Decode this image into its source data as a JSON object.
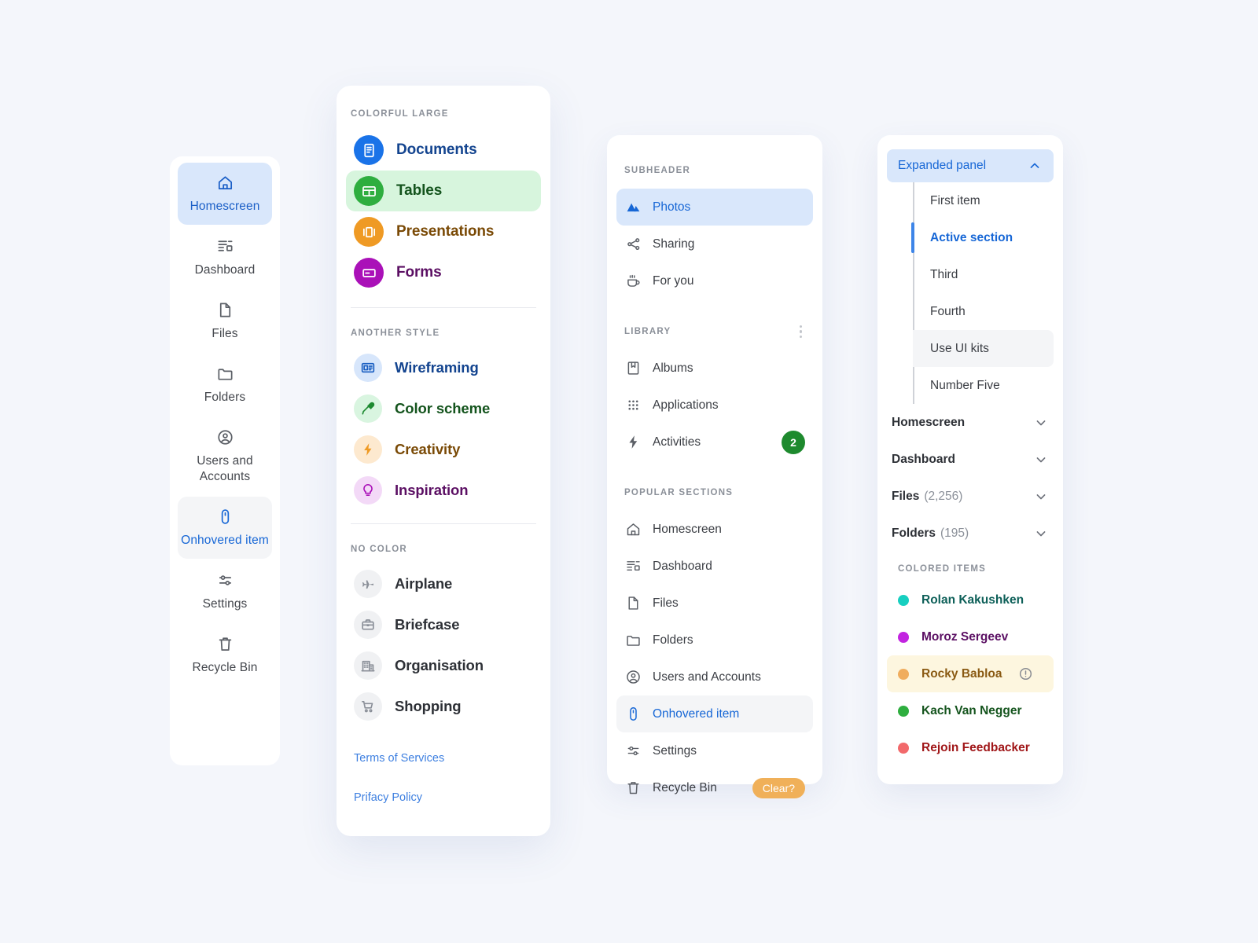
{
  "canvas": {
    "background": "#f4f6fb",
    "accent": "#1767d6"
  },
  "panel_rail": {
    "name": "icon-rail-navigation",
    "items": [
      {
        "label": "Homescreen",
        "icon": "home-icon",
        "state": "active"
      },
      {
        "label": "Dashboard",
        "icon": "dashboard-icon",
        "state": "default"
      },
      {
        "label": "Files",
        "icon": "file-icon",
        "state": "default"
      },
      {
        "label": "Folders",
        "icon": "folder-icon",
        "state": "default"
      },
      {
        "label": "Users and Accounts",
        "icon": "user-circle-icon",
        "state": "default"
      },
      {
        "label": "Onhovered item",
        "icon": "mouse-icon",
        "state": "hovered"
      },
      {
        "label": "Settings",
        "icon": "sliders-icon",
        "state": "default"
      },
      {
        "label": "Recycle Bin",
        "icon": "trash-icon",
        "state": "default"
      }
    ]
  },
  "panel_colorful": {
    "name": "colorful-large-navigation",
    "groups": [
      {
        "label": "Colorful large",
        "style": "solid-badge",
        "items": [
          {
            "label": "Documents",
            "icon": "document-icon",
            "badge_bg": "#1a73e8",
            "text_color": "#13448f",
            "selected": false
          },
          {
            "label": "Tables",
            "icon": "table-icon",
            "badge_bg": "#2eae3f",
            "text_color": "#14541d",
            "selected": true,
            "row_bg": "#d7f5dd"
          },
          {
            "label": "Presentations",
            "icon": "presentation-icon",
            "badge_bg": "#ef9a24",
            "text_color": "#7a4a06",
            "selected": false
          },
          {
            "label": "Forms",
            "icon": "form-icon",
            "badge_bg": "#aa11b8",
            "text_color": "#5b0f63",
            "selected": false
          }
        ]
      },
      {
        "label": "Another style",
        "style": "tint-badge",
        "items": [
          {
            "label": "Wireframing",
            "icon": "wireframe-icon",
            "badge_bg": "#d7e6fb",
            "glyph_color": "#1a5fc2",
            "text_color": "#13448f"
          },
          {
            "label": "Color scheme",
            "icon": "eyedropper-icon",
            "badge_bg": "#d9f5e0",
            "glyph_color": "#1d8a30",
            "text_color": "#14541d"
          },
          {
            "label": "Creativity",
            "icon": "bolt-icon",
            "badge_bg": "#fde9cf",
            "glyph_color": "#ef9a24",
            "text_color": "#7a4a06"
          },
          {
            "label": "Inspiration",
            "icon": "lightbulb-icon",
            "badge_bg": "#f3d9f7",
            "glyph_color": "#aa11b8",
            "text_color": "#5b0f63"
          }
        ]
      },
      {
        "label": "No color",
        "style": "gray-badge",
        "items": [
          {
            "label": "Airplane",
            "icon": "airplane-icon",
            "badge_bg": "#f0f1f3",
            "glyph_color": "#8b9099",
            "text_color": "#2d3036"
          },
          {
            "label": "Briefcase",
            "icon": "briefcase-icon",
            "badge_bg": "#f0f1f3",
            "glyph_color": "#8b9099",
            "text_color": "#2d3036"
          },
          {
            "label": "Organisation",
            "icon": "building-icon",
            "badge_bg": "#f0f1f3",
            "glyph_color": "#8b9099",
            "text_color": "#2d3036"
          },
          {
            "label": "Shopping",
            "icon": "cart-icon",
            "badge_bg": "#f0f1f3",
            "glyph_color": "#8b9099",
            "text_color": "#2d3036"
          }
        ]
      }
    ],
    "footer_links": [
      {
        "label": "Terms of Services"
      },
      {
        "label": "Prifacy Policy"
      }
    ]
  },
  "panel_sections": {
    "name": "sections-navigation",
    "groups": [
      {
        "label": "Subheader",
        "has_menu": false,
        "items": [
          {
            "label": "Photos",
            "icon": "mountains-icon",
            "state": "active"
          },
          {
            "label": "Sharing",
            "icon": "share-icon",
            "state": "default"
          },
          {
            "label": "For you",
            "icon": "coffee-icon",
            "state": "default"
          }
        ]
      },
      {
        "label": "Library",
        "has_menu": true,
        "menu_icon": "more-vertical-icon",
        "items": [
          {
            "label": "Albums",
            "icon": "album-icon",
            "state": "default"
          },
          {
            "label": "Applications",
            "icon": "grid-dots-icon",
            "state": "default"
          },
          {
            "label": "Activities",
            "icon": "bolt-icon",
            "state": "default",
            "badge": "2",
            "badge_bg": "#1e8a2e"
          }
        ]
      },
      {
        "label": "Popular sections",
        "has_menu": false,
        "items": [
          {
            "label": "Homescreen",
            "icon": "home-icon",
            "state": "default"
          },
          {
            "label": "Dashboard",
            "icon": "dashboard-icon",
            "state": "default"
          },
          {
            "label": "Files",
            "icon": "file-icon",
            "state": "default"
          },
          {
            "label": "Folders",
            "icon": "folder-icon",
            "state": "default"
          },
          {
            "label": "Users and Accounts",
            "icon": "user-circle-icon",
            "state": "default"
          },
          {
            "label": "Onhovered item",
            "icon": "mouse-icon",
            "state": "hovered"
          },
          {
            "label": "Settings",
            "icon": "sliders-icon",
            "state": "default"
          },
          {
            "label": "Recycle Bin",
            "icon": "trash-icon",
            "state": "default",
            "pill": "Clear?",
            "pill_bg": "#f0b059"
          }
        ]
      }
    ]
  },
  "panel_tree": {
    "name": "expanded-tree-navigation",
    "header": {
      "label": "Expanded panel",
      "chevron": "chevron-up-icon",
      "expanded": true
    },
    "sub_items": [
      {
        "label": "First item",
        "state": "default"
      },
      {
        "label": "Active section",
        "state": "active"
      },
      {
        "label": "Third",
        "state": "default"
      },
      {
        "label": "Fourth",
        "state": "default"
      },
      {
        "label": "Use UI kits",
        "state": "hovered"
      },
      {
        "label": "Number Five",
        "state": "default"
      }
    ],
    "groups": [
      {
        "label": "Homescreen",
        "count": "",
        "chevron": "chevron-down-icon"
      },
      {
        "label": "Dashboard",
        "count": "",
        "chevron": "chevron-down-icon"
      },
      {
        "label": "Files",
        "count": "(2,256)",
        "chevron": "chevron-down-icon"
      },
      {
        "label": "Folders",
        "count": "(195)",
        "chevron": "chevron-down-icon"
      }
    ],
    "colored_section_label": "Colored items",
    "colored_items": [
      {
        "label": "Rolan Kakushken",
        "dot": "#17cfc0",
        "text_color": "#0d5f58",
        "state": "default"
      },
      {
        "label": "Moroz Sergeev",
        "dot": "#c224e0",
        "text_color": "#5b0f63",
        "state": "default"
      },
      {
        "label": "Rocky Babloa",
        "dot": "#f0ad5e",
        "text_color": "#8a5a13",
        "state": "warning",
        "row_bg": "#fdf6df",
        "icon": "alert-circle-icon"
      },
      {
        "label": "Kach Van Negger",
        "dot": "#2eae3f",
        "text_color": "#14541d",
        "state": "default"
      },
      {
        "label": "Rejoin Feedbacker",
        "dot": "#f2696b",
        "text_color": "#a01618",
        "state": "default"
      }
    ]
  }
}
